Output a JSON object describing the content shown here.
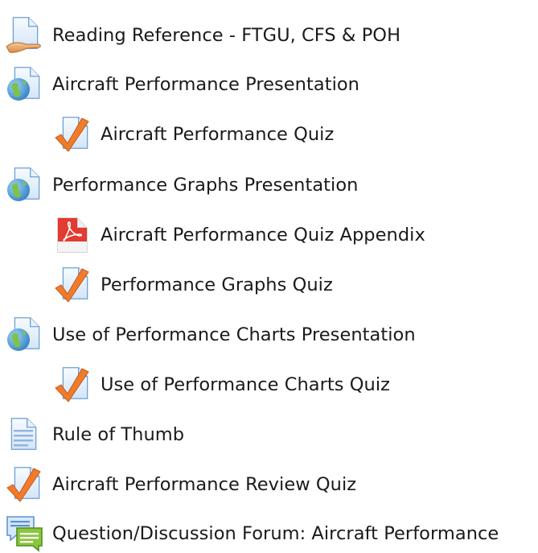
{
  "activities": [
    {
      "label": "Reading Reference - FTGU, CFS & POH",
      "icon": "page-resource-icon",
      "indent": 0
    },
    {
      "label": "Aircraft Performance Presentation",
      "icon": "url-globe-icon",
      "indent": 0
    },
    {
      "label": "Aircraft Performance Quiz",
      "icon": "quiz-check-icon",
      "indent": 1
    },
    {
      "label": "Performance Graphs Presentation",
      "icon": "url-globe-icon",
      "indent": 0
    },
    {
      "label": "Aircraft Performance Quiz Appendix",
      "icon": "pdf-icon",
      "indent": 1
    },
    {
      "label": "Performance Graphs Quiz",
      "icon": "quiz-check-icon",
      "indent": 1
    },
    {
      "label": "Use of Performance Charts Presentation",
      "icon": "url-globe-icon",
      "indent": 0
    },
    {
      "label": "Use of Performance Charts Quiz",
      "icon": "quiz-check-icon",
      "indent": 1
    },
    {
      "label": "Rule of Thumb",
      "icon": "text-page-icon",
      "indent": 0
    },
    {
      "label": "Aircraft Performance Review Quiz",
      "icon": "quiz-check-icon",
      "indent": 0
    },
    {
      "label": "Question/Discussion Forum: Aircraft Performance",
      "icon": "forum-chat-icon",
      "indent": 0
    }
  ]
}
